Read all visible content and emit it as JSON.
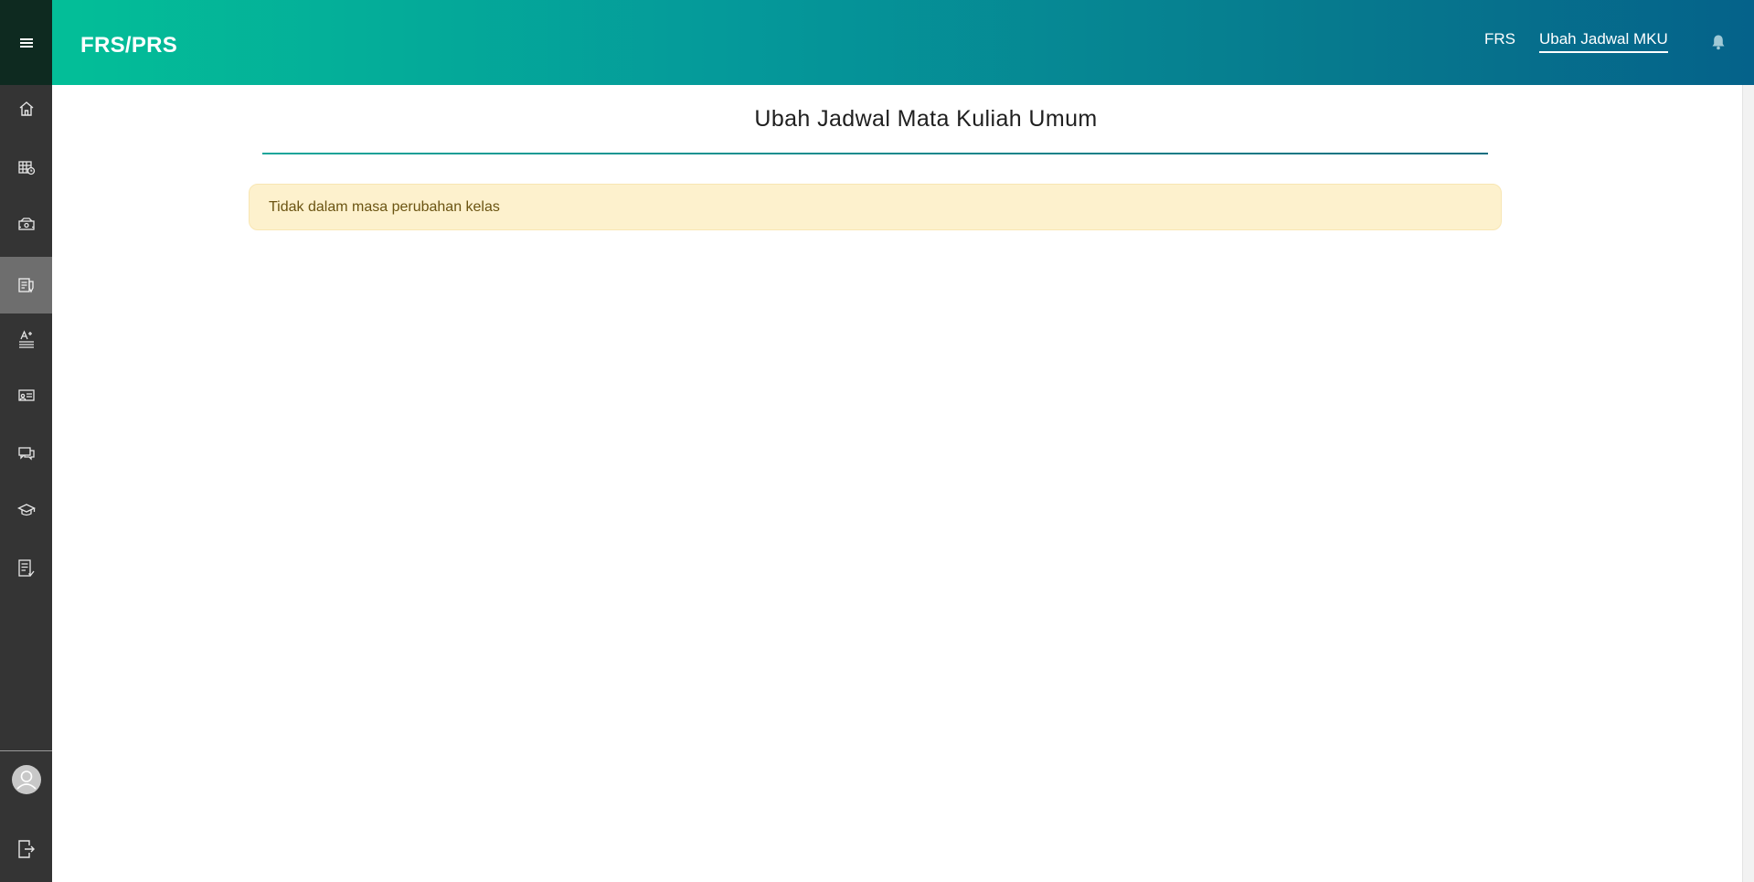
{
  "header": {
    "brand": "FRS/PRS",
    "nav": [
      {
        "label": "FRS"
      },
      {
        "label": "Ubah Jadwal MKU"
      }
    ]
  },
  "sidebar": {
    "items": [
      {
        "icon": "home-icon"
      },
      {
        "icon": "schedule-icon"
      },
      {
        "icon": "payment-icon"
      },
      {
        "icon": "frs-document-icon",
        "active": true
      },
      {
        "icon": "grade-icon"
      },
      {
        "icon": "presentation-icon"
      },
      {
        "icon": "messages-icon"
      },
      {
        "icon": "graduation-icon"
      },
      {
        "icon": "checklist-icon"
      }
    ],
    "bottom": [
      {
        "icon": "user-avatar-icon"
      },
      {
        "icon": "logout-icon"
      }
    ]
  },
  "main": {
    "title": "Ubah Jadwal Mata Kuliah Umum",
    "alert": "Tidak dalam masa perubahan kelas"
  },
  "colors": {
    "header_start": "#03bf98",
    "header_end": "#05628a",
    "sidebar": "#343434",
    "sidebar_active": "#6e6e6e",
    "alert_bg": "#fdf1cd",
    "alert_text": "#6b5412"
  }
}
